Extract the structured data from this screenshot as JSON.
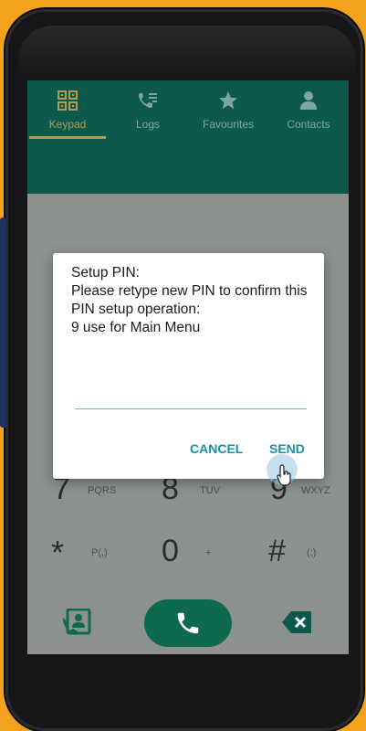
{
  "tabs": [
    {
      "label": "Keypad",
      "icon": "keypad-icon",
      "active": true
    },
    {
      "label": "Logs",
      "icon": "logs-icon",
      "active": false
    },
    {
      "label": "Favourites",
      "icon": "star-icon",
      "active": false
    },
    {
      "label": "Contacts",
      "icon": "contact-person-icon",
      "active": false
    }
  ],
  "keypad": {
    "rows": [
      [
        {
          "digit": "7",
          "letters": "PQRS"
        },
        {
          "digit": "8",
          "letters": "TUV"
        },
        {
          "digit": "9",
          "letters": "WXYZ"
        }
      ],
      [
        {
          "digit": "*",
          "letters": "P(,)"
        },
        {
          "digit": "0",
          "letters": "+"
        },
        {
          "digit": "#",
          "letters": "(;)"
        }
      ]
    ]
  },
  "dialog": {
    "message": "Setup PIN:\nPlease retype new PIN to confirm this PIN setup operation:\n9 use for Main Menu",
    "input_value": "",
    "cancel_label": "CANCEL",
    "send_label": "SEND"
  },
  "colors": {
    "header": "#0d5a4c",
    "active_tab": "#b59b50",
    "call_button": "#0d6a4f",
    "dialog_button": "#1a8fa8",
    "background": "#f4a21c"
  }
}
